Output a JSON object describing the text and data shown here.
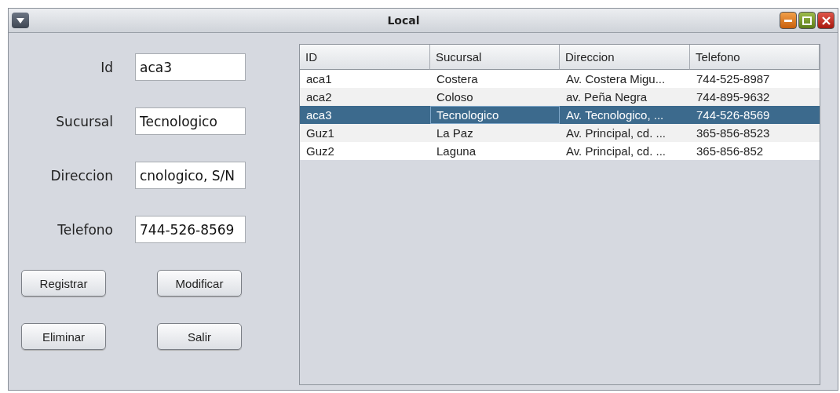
{
  "window": {
    "title": "Local"
  },
  "form": [
    {
      "label": "Id",
      "value": "aca3"
    },
    {
      "label": "Sucursal",
      "value": "Tecnologico"
    },
    {
      "label": "Direccion",
      "value": "cnologico, S/N"
    },
    {
      "label": "Telefono",
      "value": "744-526-8569"
    }
  ],
  "buttons": [
    [
      "Registrar",
      "Modificar"
    ],
    [
      "Eliminar",
      "Salir"
    ]
  ],
  "table": {
    "columns": [
      "ID",
      "Sucursal",
      "Direccion",
      "Telefono"
    ],
    "rows": [
      {
        "cells": [
          "aca1",
          "Costera",
          "Av. Costera Migu...",
          "744-525-8987"
        ],
        "selected": false
      },
      {
        "cells": [
          "aca2",
          "Coloso",
          "av. Peña Negra",
          "744-895-9632"
        ],
        "selected": false
      },
      {
        "cells": [
          "aca3",
          "Tecnologico",
          "Av. Tecnologico, ...",
          "744-526-8569"
        ],
        "selected": true
      },
      {
        "cells": [
          "Guz1",
          "La Paz",
          "Av. Principal, cd. ...",
          "365-856-8523"
        ],
        "selected": false
      },
      {
        "cells": [
          "Guz2",
          "Laguna",
          "Av. Principal, cd. ...",
          "365-856-852"
        ],
        "selected": false
      }
    ]
  }
}
